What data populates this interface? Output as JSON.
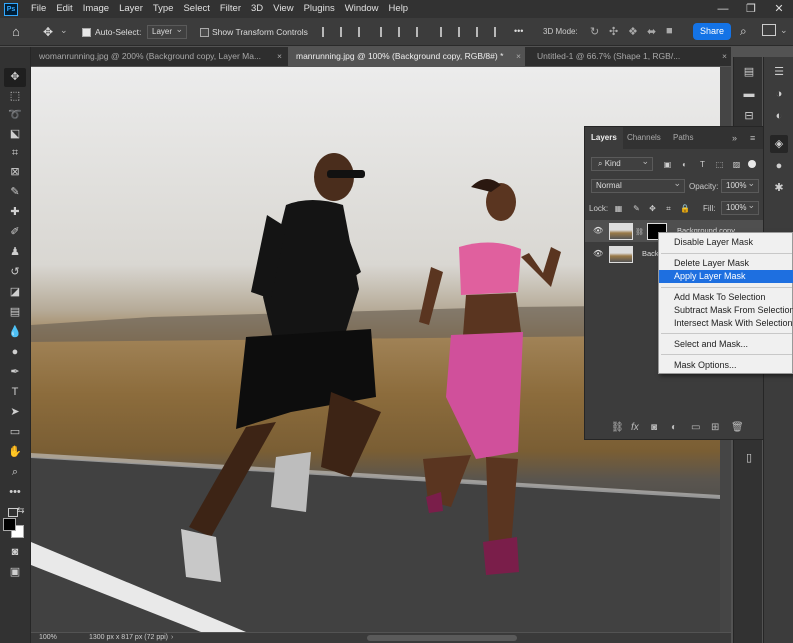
{
  "app": {
    "logo": "Ps",
    "menu": [
      "File",
      "Edit",
      "Image",
      "Layer",
      "Type",
      "Select",
      "Filter",
      "3D",
      "View",
      "Plugins",
      "Window",
      "Help"
    ]
  },
  "options_bar": {
    "auto_select_label": "Auto-Select:",
    "auto_select_value": "Layer",
    "transform_label": "Show Transform Controls",
    "mode_label": "3D Mode:",
    "more": "•••",
    "share_label": "Share"
  },
  "tabs": [
    {
      "label": "womanrunning.jpg @ 200% (Background copy, Layer Ma...",
      "close": "×"
    },
    {
      "label": "manrunning.jpg @ 100% (Background copy, RGB/8#) *",
      "close": "×"
    },
    {
      "label": "Untitled-1 @ 66.7% (Shape 1, RGB/...",
      "close": "×"
    }
  ],
  "status": {
    "zoom": "100%",
    "doc_size": "1300 px x 817 px (72 ppi)"
  },
  "layers_panel": {
    "tabs": [
      "Layers",
      "Channels",
      "Paths"
    ],
    "menu_icon": "≡",
    "collapse": "»",
    "filter_kind": "Kind",
    "blend_mode": "Normal",
    "opacity_label": "Opacity:",
    "opacity_value": "100%",
    "lock_label": "Lock:",
    "fill_label": "Fill:",
    "fill_value": "100%",
    "layers": [
      {
        "name": "Background copy"
      },
      {
        "name": "Back"
      }
    ]
  },
  "context_menu": {
    "items": [
      "Disable Layer Mask",
      "Delete Layer Mask",
      "Apply Layer Mask",
      "Add Mask To Selection",
      "Subtract Mask From Selection",
      "Intersect Mask With Selection",
      "Select and Mask...",
      "Mask Options..."
    ],
    "highlighted": "Apply Layer Mask"
  },
  "colors": {
    "accent": "#1473e6",
    "menu_highlight": "#1e6fe0",
    "panel_bg": "#3c3c3c",
    "app_bg": "#535353"
  }
}
